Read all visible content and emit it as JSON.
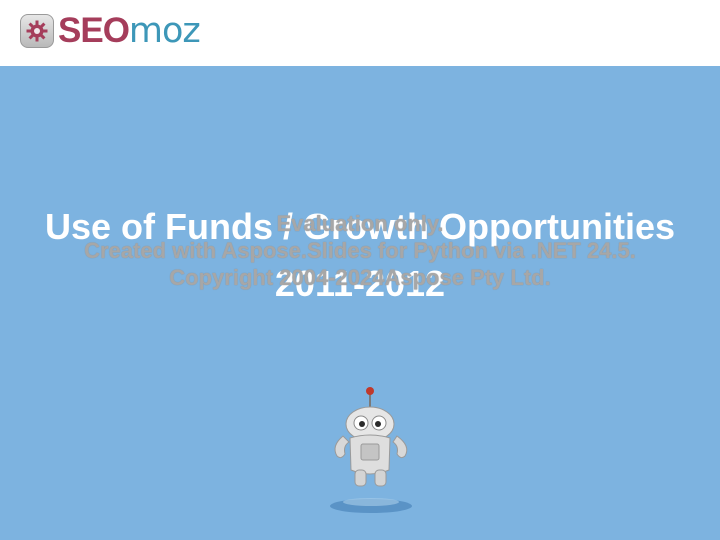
{
  "header": {
    "logo": {
      "part1": "SEO",
      "part2": "moz",
      "icon": "gear-badge-icon"
    }
  },
  "slide": {
    "title_line1": "Use of Funds / Growth Opportunities",
    "title_line2": "2011-2012",
    "mascot": "roger-robot-mascot"
  },
  "watermark": {
    "line1": "Evaluation only.",
    "line2": "Created with Aspose.Slides for Python via .NET 24.5.",
    "line3": "Copyright 2004-2024Aspose Pty Ltd."
  },
  "colors": {
    "slide_background": "#7db3e0",
    "logo_seo": "#a53d5b",
    "logo_moz": "#3d97b8",
    "title": "#ffffff",
    "watermark": "#a7a7a7"
  }
}
